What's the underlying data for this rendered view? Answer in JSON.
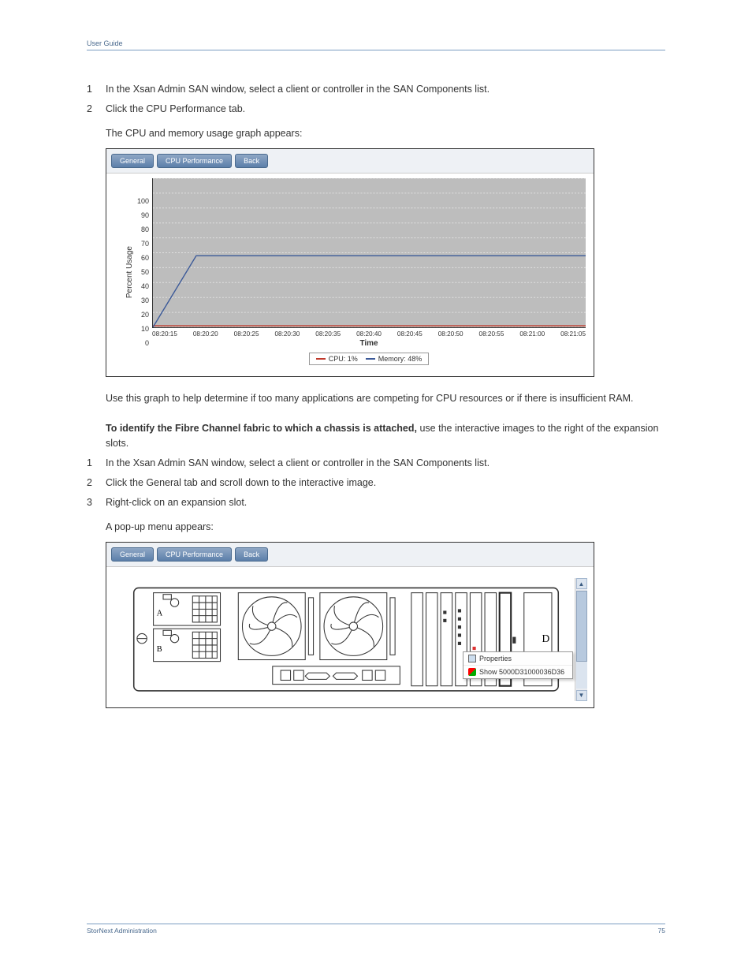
{
  "header": {
    "left": "User Guide",
    "right": "",
    "page_right": ""
  },
  "steps_top": [
    {
      "n": "1",
      "t": "In the Xsan Admin SAN window, select a client or controller in the SAN Components list."
    },
    {
      "n": "2",
      "t": "Click the CPU Performance tab."
    }
  ],
  "intro_top": "The CPU and memory usage graph appears:",
  "fig1": {
    "tabs": {
      "general": "General",
      "cpu": "CPU Performance",
      "back": "Back"
    },
    "ylabel": "Percent Usage",
    "xlabel": "Time",
    "legend": {
      "cpu": "CPU: 1%",
      "memory": "Memory: 48%"
    }
  },
  "chart_data": {
    "type": "line",
    "ylabel": "Percent Usage",
    "xlabel": "Time",
    "ylim": [
      0,
      100
    ],
    "y_ticks": [
      100,
      90,
      80,
      70,
      60,
      50,
      40,
      30,
      20,
      10,
      0
    ],
    "x_ticks": [
      "08:20:15",
      "08:20:20",
      "08:20:25",
      "08:20:30",
      "08:20:35",
      "08:20:40",
      "08:20:45",
      "08:20:50",
      "08:20:55",
      "08:21:00",
      "08:21:05"
    ],
    "series": [
      {
        "name": "CPU",
        "color": "#c0392b",
        "values": [
          1,
          1,
          1,
          1,
          1,
          1,
          1,
          1,
          1,
          1,
          1
        ]
      },
      {
        "name": "Memory",
        "color": "#3b5998",
        "values": [
          0,
          48,
          48,
          48,
          48,
          48,
          48,
          48,
          48,
          48,
          48
        ]
      }
    ]
  },
  "para1": "Use this graph to help determine if too many applications are competing for CPU resources or if there is insufficient RAM.",
  "para2_prefix": "To identify the Fibre Channel fabric to which a chassis is attached,",
  "para2_rest": " use the interactive images to the right of the expansion slots.",
  "steps_bottom": [
    {
      "n": "1",
      "t": "In the Xsan Admin SAN window, select a client or controller in the SAN Components list."
    },
    {
      "n": "2",
      "t": "Click the General tab and scroll down to the interactive image."
    },
    {
      "n": "3",
      "t": "Right-click on an expansion slot."
    }
  ],
  "intro_bottom": "A pop-up menu appears:",
  "fig2": {
    "tabs": {
      "general": "General",
      "cpu": "CPU Performance",
      "back": "Back"
    },
    "letter": "D",
    "context_menu": {
      "properties": "Properties",
      "show": "Show 5000D31000036D36"
    }
  },
  "footer": {
    "left": "StorNext Administration",
    "right": "75"
  }
}
